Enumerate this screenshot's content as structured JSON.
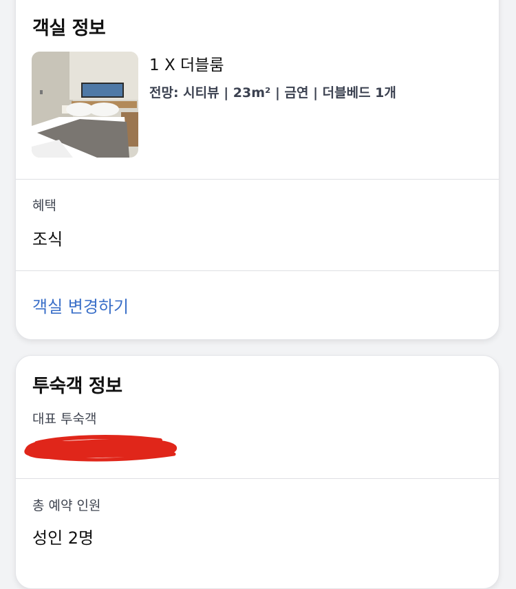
{
  "room_info": {
    "title": "객실 정보",
    "room_name": "1 X 더블룸",
    "room_details": "전망: 시티뷰 | 23m² | 금연 | 더블베드 1개",
    "benefit_label": "혜택",
    "benefit_value": "조식",
    "change_room_link": "객실 변경하기"
  },
  "guest_info": {
    "title": "투숙객 정보",
    "representative_label": "대표 투숙객",
    "total_guests_label": "총 예약 인원",
    "total_guests_value": "성인 2명"
  },
  "colors": {
    "link": "#3a6fc8",
    "redaction": "#e0261a",
    "card_background": "#ffffff",
    "page_background": "#f2f3f5"
  }
}
